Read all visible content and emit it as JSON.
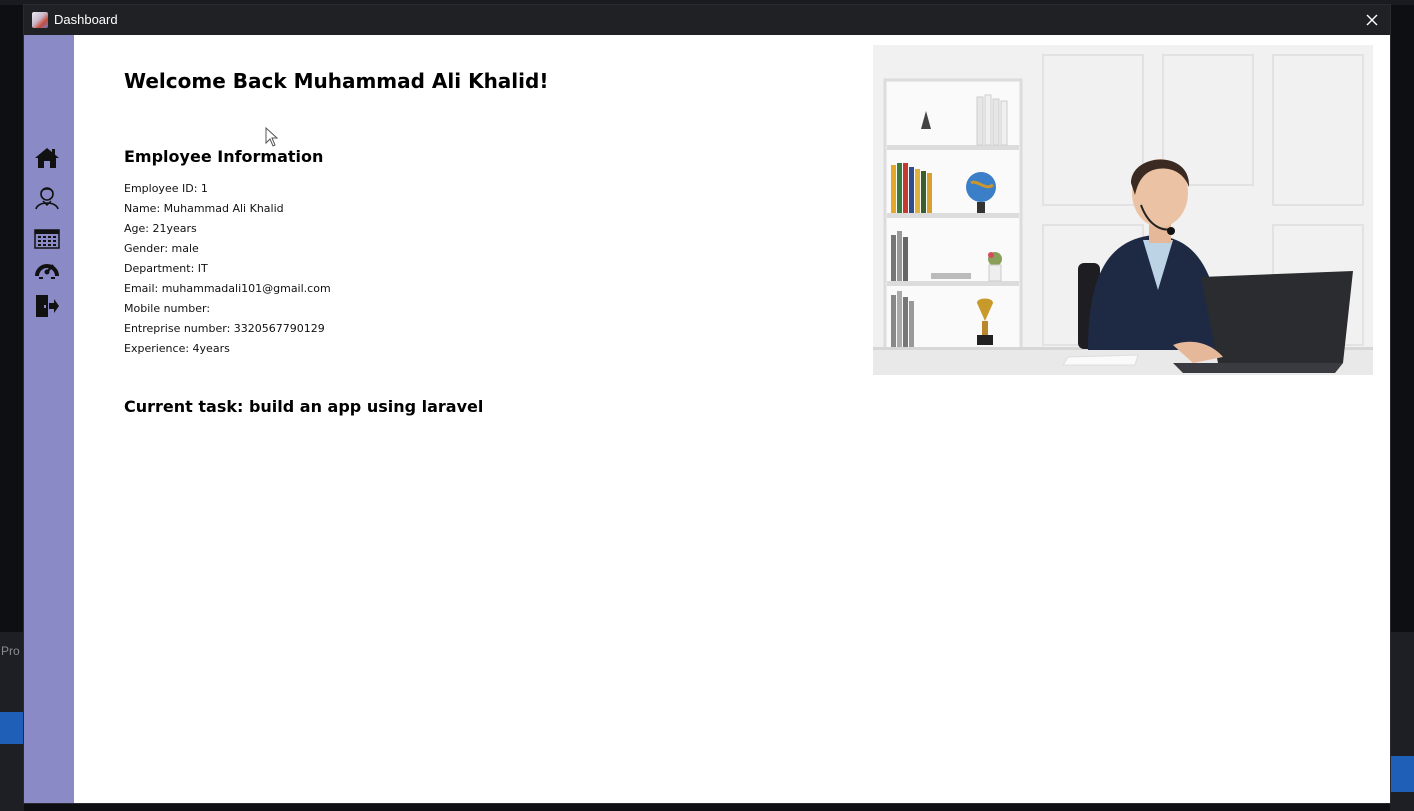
{
  "window": {
    "title": "Dashboard"
  },
  "background": {
    "left_panel_text": "Pro"
  },
  "sidebar": {
    "items": [
      {
        "icon": "home-icon"
      },
      {
        "icon": "employee-icon"
      },
      {
        "icon": "calendar-icon"
      },
      {
        "icon": "performance-gauge-icon"
      },
      {
        "icon": "logout-icon"
      }
    ],
    "color": "#8a8bc6"
  },
  "main": {
    "welcome": "Welcome Back Muhammad Ali Khalid!",
    "section_title": "Employee Information",
    "info": [
      "Employee ID: 1",
      "Name: Muhammad Ali Khalid",
      "Age: 21years",
      "Gender: male",
      "Department: IT",
      "Email: muhammadali101@gmail.com",
      "Mobile number:",
      "Entreprise number: 3320567790129",
      "Experience: 4years"
    ],
    "current_task": "Current task: build an app using laravel"
  }
}
